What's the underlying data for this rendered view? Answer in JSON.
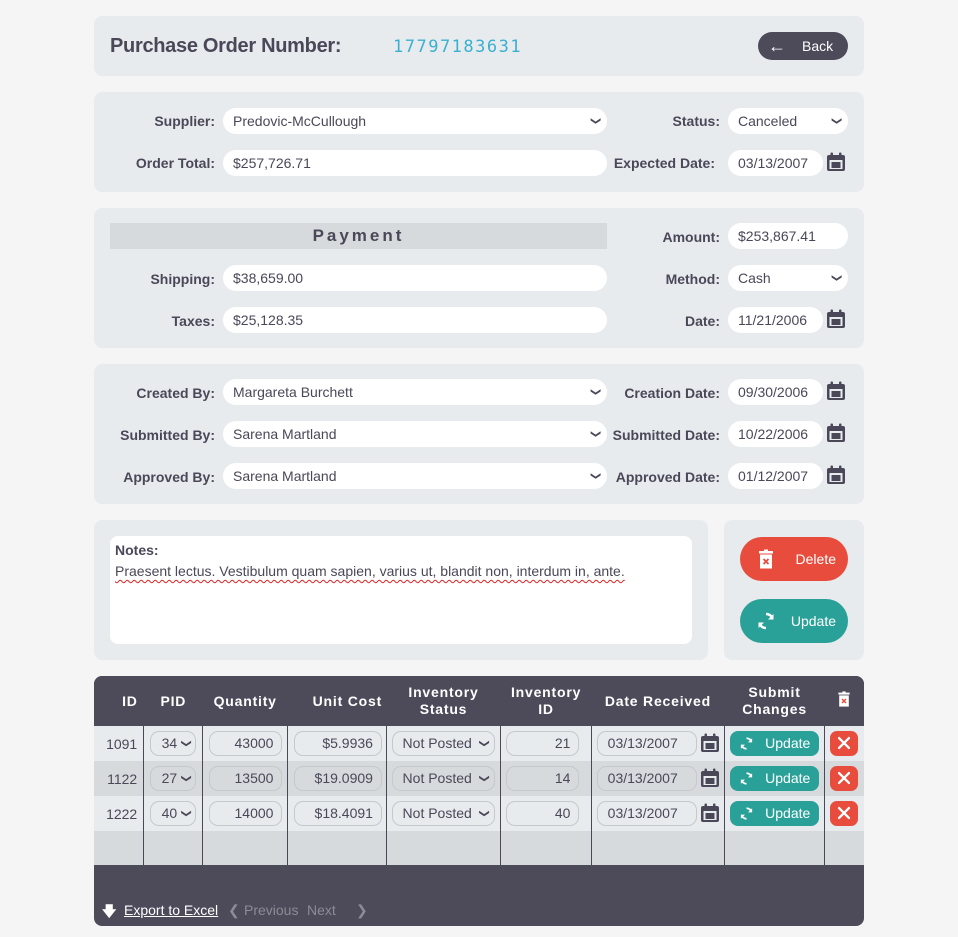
{
  "header": {
    "title": "Purchase Order Number:",
    "po_number": "17797183631",
    "back_label": "Back"
  },
  "order": {
    "supplier_label": "Supplier:",
    "supplier": "Predovic-McCullough",
    "order_total_label": "Order Total:",
    "order_total": "$257,726.71",
    "status_label": "Status:",
    "status": "Canceled",
    "expected_date_label": "Expected Date:",
    "expected_date": "03/13/2007"
  },
  "payment": {
    "title": "Payment",
    "shipping_label": "Shipping:",
    "shipping": "$38,659.00",
    "taxes_label": "Taxes:",
    "taxes": "$25,128.35",
    "amount_label": "Amount:",
    "amount": "$253,867.41",
    "method_label": "Method:",
    "method": "Cash",
    "date_label": "Date:",
    "date": "11/21/2006"
  },
  "people": {
    "created_by_label": "Created By:",
    "created_by": "Margareta Burchett",
    "submitted_by_label": "Submitted By:",
    "submitted_by": "Sarena Martland",
    "approved_by_label": "Approved By:",
    "approved_by": "Sarena Martland",
    "creation_date_label": "Creation Date:",
    "creation_date": "09/30/2006",
    "submitted_date_label": "Submitted Date:",
    "submitted_date": "10/22/2006",
    "approved_date_label": "Approved Date:",
    "approved_date": "01/12/2007"
  },
  "notes": {
    "label": "Notes:",
    "text": "Praesent lectus. Vestibulum quam sapien, varius ut, blandit non, interdum in, ante."
  },
  "actions": {
    "delete_label": "Delete",
    "update_label": "Update"
  },
  "grid": {
    "columns": [
      "ID",
      "PID",
      "Quantity",
      "Unit Cost",
      "Inventory Status",
      "Inventory ID",
      "Date Received",
      "Submit Changes"
    ],
    "rows": [
      {
        "id": "1091",
        "pid": "34",
        "quantity": "43000",
        "unit_cost": "$5.9936",
        "inventory_status": "Not Posted",
        "inventory_id": "21",
        "date_received": "03/13/2007",
        "update_label": "Update"
      },
      {
        "id": "1122",
        "pid": "27",
        "quantity": "13500",
        "unit_cost": "$19.0909",
        "inventory_status": "Not Posted",
        "inventory_id": "14",
        "date_received": "03/13/2007",
        "update_label": "Update"
      },
      {
        "id": "1222",
        "pid": "40",
        "quantity": "14000",
        "unit_cost": "$18.4091",
        "inventory_status": "Not Posted",
        "inventory_id": "40",
        "date_received": "03/13/2007",
        "update_label": "Update"
      }
    ],
    "footer": {
      "export_label": "Export to Excel",
      "previous_label": "Previous",
      "next_label": "Next"
    }
  },
  "colors": {
    "accent_blue": "#3ab0d0",
    "dark": "#4d4a5a",
    "delete_red": "#e74c3c",
    "update_teal": "#2aa198"
  }
}
